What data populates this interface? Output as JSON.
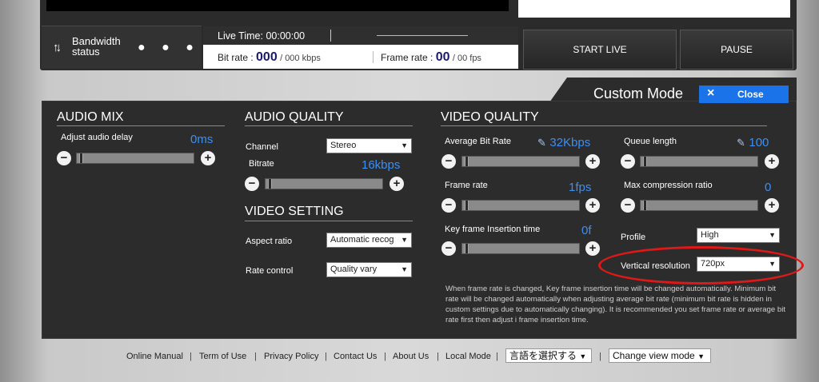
{
  "status_bar": {
    "bandwidth_label_1": "Bandwidth",
    "bandwidth_label_2": "status",
    "bandwidth_icon": "updown-arrows-icon",
    "dots": "● ● ●",
    "live_time_label": "Live Time:",
    "live_time_value": "00:00:00",
    "bit_rate_label": "Bit rate :",
    "bit_rate_value": "000",
    "bit_rate_unit": "/ 000 kbps",
    "frame_rate_label": "Frame rate",
    "frame_rate_colon": ":",
    "frame_rate_value": "00",
    "frame_rate_unit": "/ 00 fps",
    "start_live_label": "START LIVE",
    "pause_label": "PAUSE"
  },
  "custom_mode": {
    "title": "Custom Mode",
    "close_label": "Close",
    "close_icon": "×"
  },
  "audio_mix": {
    "heading": "AUDIO MIX",
    "delay_label": "Adjust audio delay",
    "delay_value": "0ms"
  },
  "audio_quality": {
    "heading": "AUDIO QUALITY",
    "channel_label": "Channel",
    "channel_value": "Stereo",
    "bitrate_label": "Bitrate",
    "bitrate_value": "16kbps"
  },
  "video_setting": {
    "heading": "VIDEO SETTING",
    "aspect_label": "Aspect ratio",
    "aspect_value": "Automatic recog",
    "rate_control_label": "Rate control",
    "rate_control_value": "Quality vary"
  },
  "video_quality": {
    "heading": "VIDEO QUALITY",
    "avg_bitrate_label": "Average Bit Rate",
    "avg_bitrate_value": "32Kbps",
    "frame_rate_label": "Frame rate",
    "frame_rate_value": "1fps",
    "keyframe_label": "Key frame Insertion time",
    "keyframe_value": "0f",
    "queue_label": "Queue length",
    "queue_value": "100",
    "max_compression_label": "Max compression ratio",
    "max_compression_value": "0",
    "profile_label": "Profile",
    "profile_value": "High",
    "vres_label": "Vertical resolution",
    "vres_value": "720px",
    "note": "When frame rate is changed, Key frame insertion time will be changed automatically. Minimum bit rate will be changed automatically when adjusting average bit rate (minimum bit rate is hidden in custom settings due to automatically changing). It is recommended you set frame rate or average bit rate first then adjust i frame insertion time."
  },
  "footer": {
    "online_manual": "Online Manual",
    "term_of_use": "Term of Use",
    "privacy_policy": "Privacy Policy",
    "contact_us": "Contact Us",
    "about_us": "About Us",
    "local_mode": "Local Mode",
    "language_select": "言語を選択する",
    "view_mode_select": "Change view mode",
    "separator": "|"
  },
  "icons": {
    "minus": "−",
    "plus": "+",
    "pencil": "✎",
    "dropdown": "▼"
  },
  "colors": {
    "accent_blue": "#3b8ff5",
    "close_button": "#1a73e8",
    "highlight_oval": "#e01818"
  }
}
